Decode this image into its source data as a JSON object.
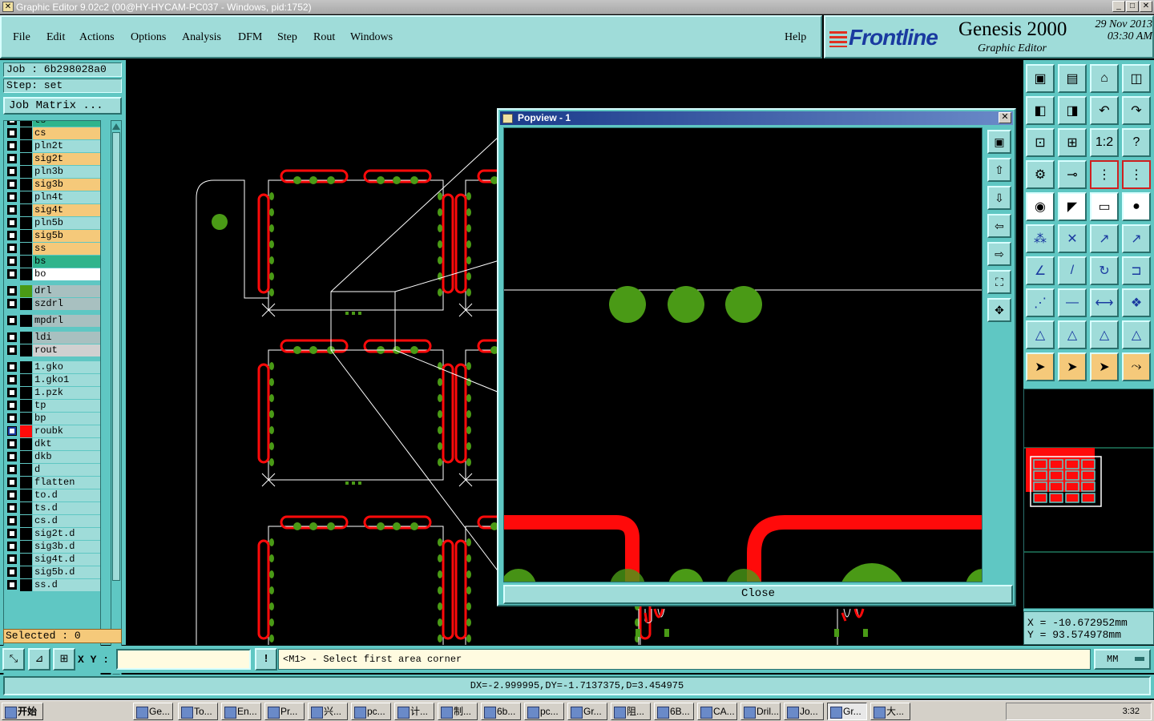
{
  "window": {
    "title": "Graphic Editor 9.02c2 (00@HY-HYCAM-PC037 - Windows, pid:1752)",
    "btn_min": "_",
    "btn_max": "□",
    "btn_close": "✕"
  },
  "menu": {
    "file": "File",
    "edit": "Edit",
    "actions": "Actions",
    "options": "Options",
    "analysis": "Analysis",
    "dfm": "DFM",
    "step": "Step",
    "rout": "Rout",
    "windows": "Windows",
    "help": "Help"
  },
  "brand": {
    "logo": "Frontline",
    "product": "Genesis 2000",
    "subtitle": "Graphic Editor",
    "date": "29 Nov 2013",
    "time": "03:30 AM"
  },
  "job": {
    "job_label": "Job : 6b298028a0",
    "step_label": "Step: set",
    "matrix_button": "Job Matrix ..."
  },
  "layers": [
    {
      "name": "ts",
      "color": "#2fb48c"
    },
    {
      "name": "cs",
      "color": "#f5c97a"
    },
    {
      "name": "pln2t",
      "color": "#9fdcd9"
    },
    {
      "name": "sig2t",
      "color": "#f5c97a"
    },
    {
      "name": "pln3b",
      "color": "#9fdcd9"
    },
    {
      "name": "sig3b",
      "color": "#f5c97a"
    },
    {
      "name": "pln4t",
      "color": "#9fdcd9"
    },
    {
      "name": "sig4t",
      "color": "#f5c97a"
    },
    {
      "name": "pln5b",
      "color": "#9fdcd9"
    },
    {
      "name": "sig5b",
      "color": "#f5c97a"
    },
    {
      "name": "ss",
      "color": "#f5c97a"
    },
    {
      "name": "bs",
      "color": "#2fb48c"
    },
    {
      "name": "bo",
      "color": "#ffffff"
    },
    {
      "name": "drl",
      "color": "#a8c0c0"
    },
    {
      "name": "szdrl",
      "color": "#a8c0c0"
    },
    {
      "name": "mpdrl",
      "color": "#a8c0c0"
    },
    {
      "name": "ldi",
      "color": "#a8c0c0"
    },
    {
      "name": "rout",
      "color": "#d0d0d0"
    },
    {
      "name": "1.gko",
      "color": "#9fdcd9"
    },
    {
      "name": "1.gko1",
      "color": "#9fdcd9"
    },
    {
      "name": "1.pzk",
      "color": "#9fdcd9"
    },
    {
      "name": "tp",
      "color": "#9fdcd9"
    },
    {
      "name": "bp",
      "color": "#9fdcd9"
    },
    {
      "name": "roubk",
      "color": "#9fdcd9"
    },
    {
      "name": "dkt",
      "color": "#9fdcd9"
    },
    {
      "name": "dkb",
      "color": "#9fdcd9"
    },
    {
      "name": "d",
      "color": "#9fdcd9"
    },
    {
      "name": "flatten",
      "color": "#9fdcd9"
    },
    {
      "name": "to.d",
      "color": "#9fdcd9"
    },
    {
      "name": "ts.d",
      "color": "#9fdcd9"
    },
    {
      "name": "cs.d",
      "color": "#9fdcd9"
    },
    {
      "name": "sig2t.d",
      "color": "#9fdcd9"
    },
    {
      "name": "sig3b.d",
      "color": "#9fdcd9"
    },
    {
      "name": "sig4t.d",
      "color": "#9fdcd9"
    },
    {
      "name": "sig5b.d",
      "color": "#9fdcd9"
    },
    {
      "name": "ss.d",
      "color": "#9fdcd9"
    }
  ],
  "selected": "Selected : 0",
  "popview": {
    "title": "Popview - 1",
    "close_label": "Close",
    "close_x": "✕"
  },
  "coords": {
    "x": "X = -10.672952mm",
    "y": "Y = 93.574978mm"
  },
  "command": {
    "xy_label": "X Y :",
    "xy_value": "",
    "info_icon": "!",
    "prompt": "<M1> - Select first area corner",
    "units": "MM"
  },
  "status": "DX=-2.999995,DY=-1.7137375,D=3.454975",
  "colors": {
    "panel": "#5fc7c3",
    "light": "#9fdcd9",
    "pad": "#4a9a16",
    "trace": "#ff0a0a"
  },
  "taskbar": {
    "start": "开始",
    "items": [
      "Ge...",
      "To...",
      "En...",
      "Pr...",
      "兴...",
      "pc...",
      "计...",
      "制...",
      "6b...",
      "pc...",
      "Gr...",
      "阻...",
      "6B...",
      "CA...",
      "Dril...",
      "Jo...",
      "Gr...",
      "大..."
    ],
    "clock": "3:32"
  }
}
